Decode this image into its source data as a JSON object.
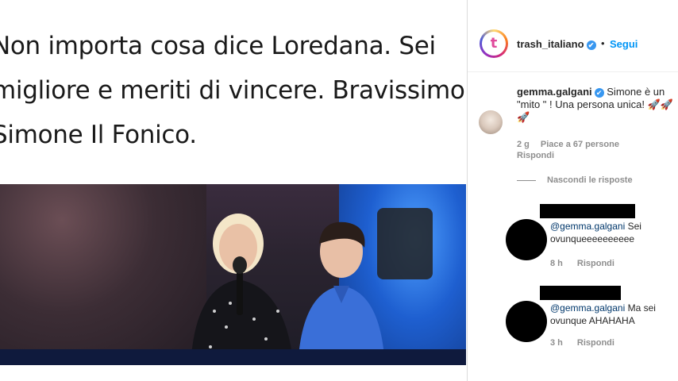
{
  "tweet": {
    "lines": [
      "Non importa cosa dice Loredana. Sei",
      "migliore e meriti di vincere. Bravissimo",
      "Simone Il Fonico."
    ]
  },
  "header": {
    "username": "trash_italiano",
    "verified_icon": "✔",
    "dot": "•",
    "follow_label": "Segui",
    "avatar_logo": "t"
  },
  "comment": {
    "username": "gemma.galgani",
    "verified_icon": "✔",
    "text": "Simone è un \"mito \" ! Una persona unica! 🚀🚀🚀",
    "time": "2 g",
    "likes": "Piace a 67 persone",
    "reply_label": "Rispondi"
  },
  "hide_replies_label": "Nascondi le risposte",
  "replies": [
    {
      "mention": "@gemma.galgani",
      "text": " Sei ovunqueeeeeeeeee",
      "time": "8 h",
      "reply_label": "Rispondi"
    },
    {
      "mention": "@gemma.galgani",
      "text": " Ma sei ovunque AHAHAHA",
      "time": "3 h",
      "reply_label": "Rispondi"
    }
  ],
  "colors": {
    "accent": "#0095f6",
    "verified": "#3897f0",
    "muted": "#8e8e8e",
    "text": "#262626"
  }
}
